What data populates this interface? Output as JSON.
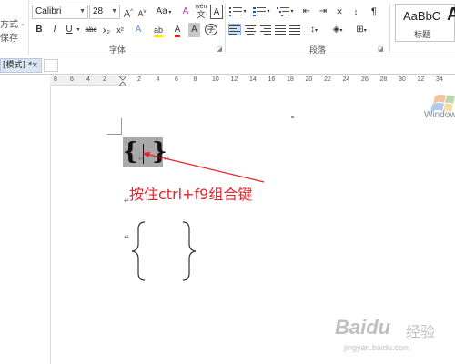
{
  "ribbon": {
    "left_items": [
      "方式 -",
      "保存"
    ],
    "font": {
      "name": "Calibri",
      "size": "28"
    },
    "font_buttons": {
      "grow": "A",
      "shrink": "A",
      "case": "Aa",
      "clear": "A",
      "phonetic": "wén",
      "charborder": "A",
      "bold": "B",
      "italic": "I",
      "underline": "U",
      "strike": "abc",
      "subscript": "x₂",
      "superscript": "x²",
      "highlight": "ab",
      "fontcolor": "A",
      "charshade": "A",
      "enclose": "字"
    },
    "groups": {
      "font": "字体",
      "paragraph": "段落"
    },
    "style_gallery": {
      "sample": "AaBbC",
      "big": "A",
      "name": "标题"
    }
  },
  "tabbar": {
    "doc_tab_label": "[模式] *",
    "close": "×"
  },
  "ruler": {
    "ticks": [
      "8",
      "6",
      "4",
      "2",
      "2",
      "4",
      "6",
      "8",
      "10",
      "12",
      "14",
      "16",
      "18",
      "20",
      "22",
      "24",
      "26",
      "28",
      "30",
      "32",
      "34"
    ]
  },
  "document": {
    "field_braces": [
      "{",
      "}"
    ],
    "para_mark": "↵",
    "annotation": "按住ctrl+f9组合键",
    "windows_text": "Window"
  },
  "watermark": {
    "brand": "Baidu",
    "sub": "jingyan.baidu.com"
  },
  "colors": {
    "annotation": "#e8232a",
    "field_shading": "#a9a9a9",
    "tab_active": "#dce6f2"
  }
}
